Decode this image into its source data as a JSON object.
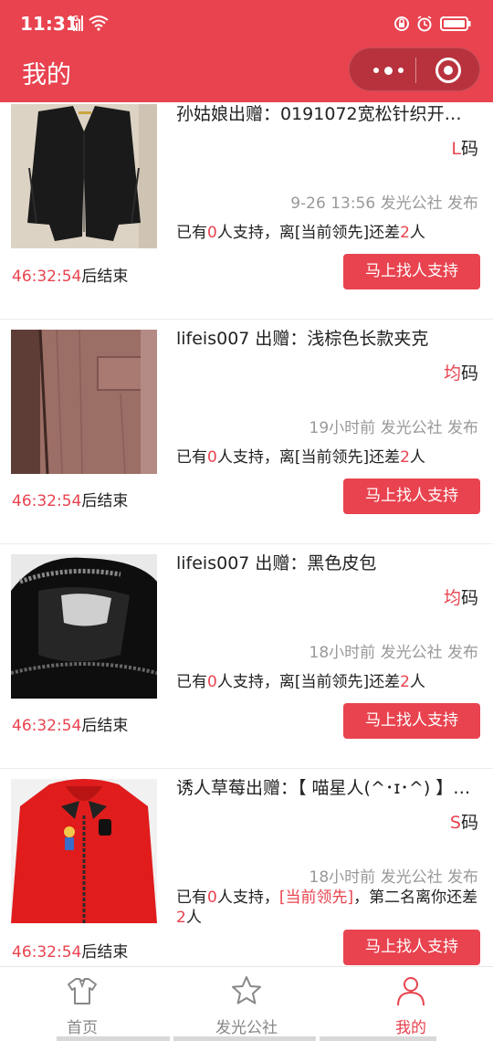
{
  "status": {
    "time": "11:31",
    "net": "4G"
  },
  "header": {
    "title": "我的"
  },
  "colors": {
    "accent": "#e8434f",
    "muted": "#999999"
  },
  "items": [
    {
      "title": "孙姑娘出赠：0191072宽松针织开…",
      "size_value": "L",
      "size_unit": "码",
      "meta": "9-26 13:56 发光公社 发布",
      "support": {
        "p1": "已有",
        "n1": "0",
        "p2": "人支持，离[当前领先]还差",
        "n2": "2",
        "p3": "人"
      },
      "countdown_time": "46:32:54",
      "countdown_suffix": "后结束",
      "button": "马上找人支持",
      "thumb_icon": "black-cardigan-photo"
    },
    {
      "title": "lifeis007 出赠：浅棕色长款夹克",
      "size_value": "均",
      "size_unit": "码",
      "meta": "19小时前 发光公社 发布",
      "support": {
        "p1": "已有",
        "n1": "0",
        "p2": "人支持，离[当前领先]还差",
        "n2": "2",
        "p3": "人"
      },
      "countdown_time": "46:32:54",
      "countdown_suffix": "后结束",
      "button": "马上找人支持",
      "thumb_icon": "brown-jacket-photo"
    },
    {
      "title": "lifeis007 出赠：黑色皮包",
      "size_value": "均",
      "size_unit": "码",
      "meta": "18小时前 发光公社 发布",
      "support": {
        "p1": "已有",
        "n1": "0",
        "p2": "人支持，离[当前领先]还差",
        "n2": "2",
        "p3": "人"
      },
      "countdown_time": "46:32:54",
      "countdown_suffix": "后结束",
      "button": "马上找人支持",
      "thumb_icon": "black-leather-bag-photo"
    },
    {
      "title": "诱人草莓出赠：【 喵星人(^･ɪ･^) 】…",
      "size_value": "S",
      "size_unit": "码",
      "meta": "18小时前 发光公社 发布",
      "support": {
        "p1": "已有",
        "n1": "0",
        "p2": "人支持，",
        "lead": "[当前领先]",
        "p3": "，第二名离你还差",
        "n2": "2",
        "p4": "人"
      },
      "countdown_time": "46:32:54",
      "countdown_suffix": "后结束",
      "button": "马上找人支持",
      "thumb_icon": "red-hoodie-photo"
    }
  ],
  "tabbar": [
    {
      "label": "首页",
      "icon": "shirt-icon",
      "active": false
    },
    {
      "label": "发光公社",
      "icon": "star-icon",
      "active": false
    },
    {
      "label": "我的",
      "icon": "user-icon",
      "active": true
    }
  ]
}
